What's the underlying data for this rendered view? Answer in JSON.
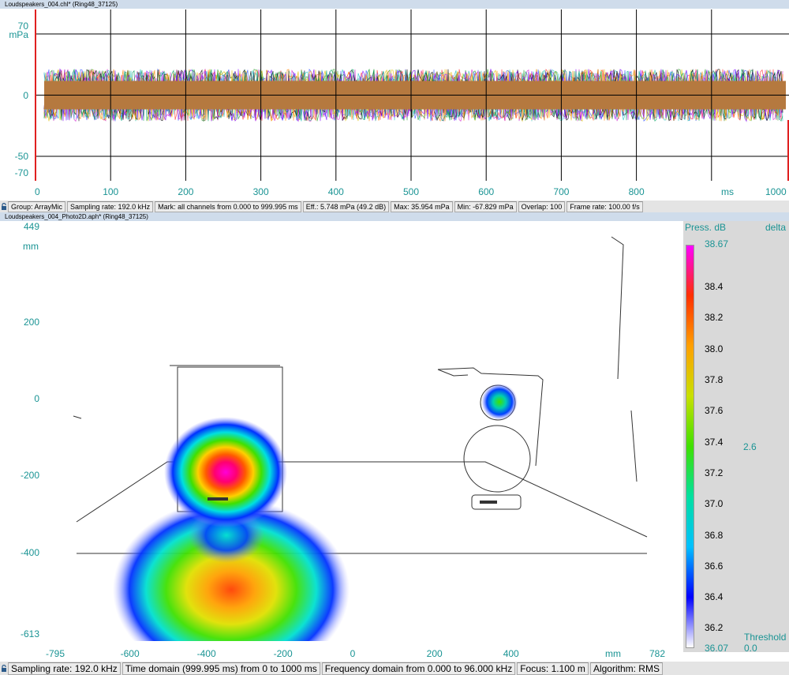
{
  "time_window": {
    "title": "Loudspeakers_004.chl* (Ring48_37125)",
    "y_unit": "mPa",
    "x_unit": "ms",
    "y_ticks": [
      {
        "label": "70",
        "value": 70
      },
      {
        "label": "0",
        "value": 0
      },
      {
        "label": "-50",
        "value": -50
      },
      {
        "label": "-70",
        "value": -70
      }
    ],
    "x_ticks": [
      "0",
      "100",
      "200",
      "300",
      "400",
      "500",
      "600",
      "700",
      "800",
      "1000"
    ],
    "x_tick_values": [
      0,
      100,
      200,
      300,
      400,
      500,
      600,
      700,
      800,
      1000
    ],
    "grid_x": [
      100,
      200,
      300,
      400,
      500,
      600,
      700,
      800,
      900
    ],
    "grid_y": [
      50,
      0,
      -50
    ],
    "colors": {
      "grid": "#000000",
      "axis": "#1a9494",
      "envelope": "#b5793f",
      "marker": "#e02020"
    }
  },
  "status_time": {
    "group": "Group: ArrayMic",
    "sampling": "Sampling rate: 192.0 kHz",
    "mark": "Mark: all channels from 0.000 to 999.995 ms",
    "eff": "Eff.: 5.748 mPa (49.2 dB)",
    "max": "Max: 35.954 mPa",
    "min": "Min: -67.829 mPa",
    "overlap": "Overlap: 100",
    "frame": "Frame rate: 100.00 f/s"
  },
  "photo_window": {
    "title": "Loudspeakers_004_Photo2D.aph* (Ring48_37125)",
    "y_unit": "mm",
    "x_unit": "mm",
    "y_ticks": [
      {
        "label": "449",
        "value": 449
      },
      {
        "label": "200",
        "value": 200
      },
      {
        "label": "0",
        "value": 0
      },
      {
        "label": "-200",
        "value": -200
      },
      {
        "label": "-400",
        "value": -400
      },
      {
        "label": "-613",
        "value": -613
      }
    ],
    "x_ticks": [
      {
        "label": "-795",
        "value": -795
      },
      {
        "label": "-600",
        "value": -600
      },
      {
        "label": "-400",
        "value": -400
      },
      {
        "label": "-200",
        "value": -200
      },
      {
        "label": "0",
        "value": 0
      },
      {
        "label": "200",
        "value": 200
      },
      {
        "label": "400",
        "value": 400
      },
      {
        "label": "782",
        "value": 782
      }
    ],
    "x_range": [
      -795,
      782
    ],
    "y_range": [
      -613,
      449
    ]
  },
  "legend": {
    "header_left": "Press. dB",
    "header_right": "delta",
    "top_value": "38.67",
    "bottom_value": "36.07",
    "ticks": [
      "38.4",
      "38.2",
      "38.0",
      "37.8",
      "37.6",
      "37.4",
      "37.2",
      "37.0",
      "36.8",
      "36.6",
      "36.4",
      "36.2"
    ],
    "tick_values": [
      38.4,
      38.2,
      38.0,
      37.8,
      37.6,
      37.4,
      37.2,
      37.0,
      36.8,
      36.6,
      36.4,
      36.2
    ],
    "range": [
      36.07,
      38.67
    ],
    "delta_value": "2.6",
    "threshold_label": "Threshold",
    "threshold_value": "0.0",
    "gradient": [
      "#ffffff",
      "#0000ff",
      "#00c0ff",
      "#00e0a0",
      "#40e000",
      "#c8e000",
      "#ffa000",
      "#ff3000",
      "#ff00ff"
    ]
  },
  "status_photo": {
    "sampling": "Sampling rate: 192.0 kHz",
    "time_domain": "Time domain (999.995 ms) from 0 to 1000 ms",
    "freq_domain": "Frequency domain from 0.000 to 96.000 kHz",
    "focus": "Focus: 1.100 m",
    "algorithm": "Algorithm: RMS"
  }
}
